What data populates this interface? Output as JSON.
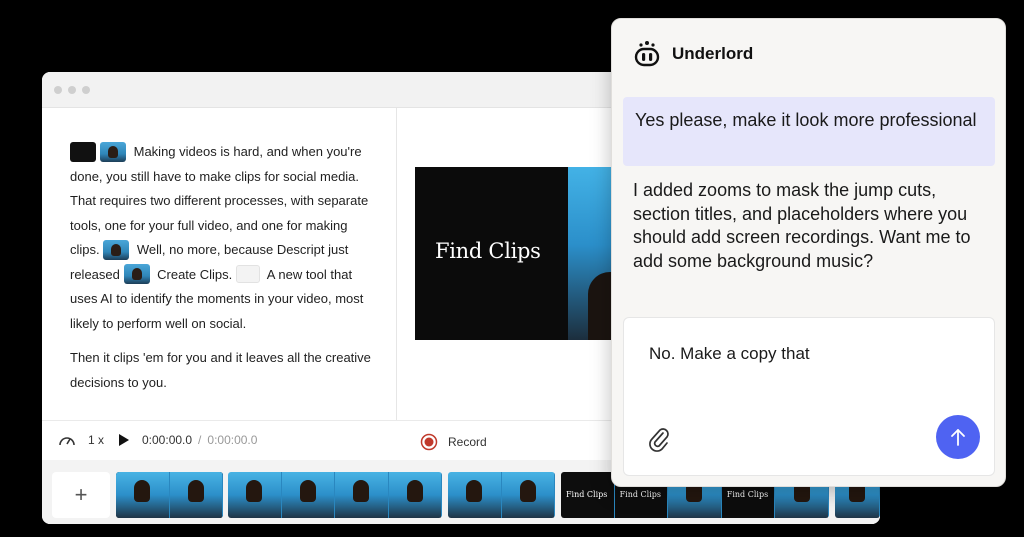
{
  "script": {
    "p1_a": "Making videos is hard, and when you're done, you still have to make clips for social media. That requires two different processes, with separate tools, one for your full video, and one for making clips.",
    "p1_b": "Well, no more, because Descript just released",
    "p1_c": "Create Clips.",
    "p1_d": "A new tool that uses AI to identify the moments in your video, most likely to perform well on social.",
    "p2": "Then it clips 'em for you and it leaves all the creative decisions to you."
  },
  "preview": {
    "title": "Find Clips"
  },
  "controls": {
    "speed": "1 x",
    "time_current": "0:00:00.0",
    "time_separator": "/",
    "time_total": "0:00:00.0",
    "record_label": "Record"
  },
  "timeline": {
    "add_label": "+",
    "text_clip_label": "Find Clips"
  },
  "underlord": {
    "title": "Underlord",
    "user_message": "Yes please, make it look more professional",
    "bot_message": "I added zooms to mask the jump cuts, section titles, and placeholders where you should add screen recordings. Want me to add some background music?",
    "composer_value": "No. Make a copy that"
  },
  "colors": {
    "accent": "#4f63f2",
    "user_bubble": "#e6e6fb",
    "record": "#c0392b"
  },
  "icons": [
    "speed-icon",
    "play-icon",
    "record-icon",
    "add-icon",
    "robot-icon",
    "paperclip-icon",
    "arrow-up-icon"
  ]
}
